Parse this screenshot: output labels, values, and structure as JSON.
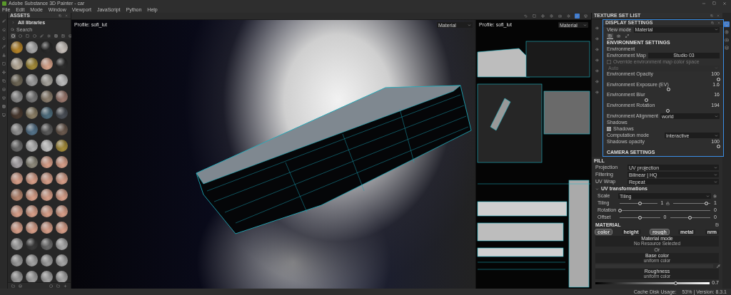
{
  "window": {
    "title": "Adobe Substance 3D Painter - car"
  },
  "menu": [
    "File",
    "Edit",
    "Mode",
    "Window",
    "Viewport",
    "JavaScript",
    "Python",
    "Help"
  ],
  "assets": {
    "title": "ASSETS",
    "library": "All libraries",
    "search": {
      "placeholder": "Search"
    },
    "filters": [
      {
        "selected": true
      },
      {
        "selected": false
      },
      {
        "selected": false
      },
      {
        "selected": false
      },
      {
        "selected": false
      },
      {
        "selected": false
      },
      {
        "selected": false
      },
      {
        "selected": false
      },
      {
        "selected": false
      }
    ],
    "materials": [
      {
        "color": "#b8862a"
      },
      {
        "color": "#a9a9a9"
      },
      {
        "color": "#2a2a2a"
      },
      {
        "color": "#c9c2bc"
      },
      {
        "color": "#b6aa98"
      },
      {
        "color": "#a48c3a"
      },
      {
        "color": "#d9a58c"
      },
      {
        "color": "#2c2c2c"
      },
      {
        "color": "#6d6655"
      },
      {
        "color": "#9a9a9a"
      },
      {
        "color": "#a6a39c"
      },
      {
        "color": "#bdbdbd"
      },
      {
        "color": "#8a8a8a"
      },
      {
        "color": "#777777"
      },
      {
        "color": "#8c7f6e"
      },
      {
        "color": "#9c7a70"
      },
      {
        "color": "#4a3a30"
      },
      {
        "color": "#8b7f66"
      },
      {
        "color": "#4f6e7e"
      },
      {
        "color": "#4a4f56"
      },
      {
        "color": "#8f8f8f"
      },
      {
        "color": "#55738a"
      },
      {
        "color": "#5a5a5a"
      },
      {
        "color": "#6b5a4e"
      },
      {
        "color": "#6a6a6a"
      },
      {
        "color": "#b0b0b0"
      },
      {
        "color": "#c4c4c4"
      },
      {
        "color": "#a88f3c"
      },
      {
        "color": "#a7a3a6"
      },
      {
        "color": "#8e8a7c"
      },
      {
        "color": "#d9a08a"
      },
      {
        "color": "#d9a08a"
      },
      {
        "color": "#d9a08a"
      },
      {
        "color": "#d9a08a"
      },
      {
        "color": "#d9a08a"
      },
      {
        "color": "#d9a08a"
      },
      {
        "color": "#b7866f"
      },
      {
        "color": "#d9a08a"
      },
      {
        "color": "#d9a08a"
      },
      {
        "color": "#d9a08a"
      },
      {
        "color": "#d9a08a"
      },
      {
        "color": "#d9a08a"
      },
      {
        "color": "#d9a08a"
      },
      {
        "color": "#d9a08a"
      },
      {
        "color": "#d9a08a"
      },
      {
        "color": "#d9a08a"
      },
      {
        "color": "#d9a08a"
      },
      {
        "color": "#d9a08a"
      },
      {
        "color": "#9c9c9c"
      },
      {
        "color": "#3a3a3a"
      },
      {
        "color": "#6a6a6a"
      },
      {
        "color": "#a8a8a8"
      },
      {
        "color": "#9a9a9a"
      },
      {
        "color": "#a2a2a2"
      },
      {
        "color": "#9e9e9e"
      },
      {
        "color": "#a6a6a6"
      },
      {
        "color": "#999999"
      },
      {
        "color": "#a0a0a0"
      },
      {
        "color": "#a3a3a3"
      },
      {
        "color": "#a5a5a5"
      }
    ]
  },
  "viewport_3d": {
    "profile": "Profile: sofl_lut",
    "mode": "Material"
  },
  "viewport_2d": {
    "profile": "Profile: sofl_lut",
    "mode": "Material"
  },
  "texture_set_list": {
    "title": "TEXTURE SET LIST"
  },
  "side_tabs": [
    {
      "selected": true
    },
    {
      "selected": false
    },
    {
      "selected": false
    },
    {
      "selected": false
    }
  ],
  "display_settings": {
    "title": "DISPLAY SETTINGS",
    "view_mode": {
      "label": "View mode",
      "value": "Material"
    },
    "tabs": [
      {
        "selected": true
      },
      {
        "selected": false
      },
      {
        "selected": false
      }
    ],
    "section": "ENVIRONMENT SETTINGS",
    "group": "Environment",
    "environment_map": {
      "label": "Environment Map",
      "value": "Studio 03"
    },
    "override": {
      "label": "Override environment map color space",
      "checked": false,
      "disabled": true
    },
    "color_space": {
      "value": "Auto",
      "disabled": true
    },
    "sliders": [
      {
        "label": "Environment Opacity",
        "reading": "100",
        "level": 1
      },
      {
        "label": "Environment Exposure (EV)",
        "reading": "1.6",
        "level": 0.55
      },
      {
        "label": "Environment Blur",
        "reading": "16",
        "level": 0.35
      },
      {
        "label": "Environment Rotation",
        "reading": "194",
        "level": 0.54
      }
    ],
    "alignment": {
      "label": "Environment Alignment",
      "value": "world"
    },
    "shadows_group": "Shadows",
    "shadows": {
      "label": "Shadows",
      "checked": true
    },
    "computation": {
      "label": "Computation mode",
      "value": "Interactive"
    },
    "shadows_opacity": {
      "label": "Shadows opacity",
      "reading": "100",
      "level": 1
    },
    "camera_section": "CAMERA SETTINGS"
  },
  "fill": {
    "title": "FILL",
    "fields": [
      {
        "label": "Projection",
        "value": "UV projection"
      },
      {
        "label": "Filtering",
        "value": "Bilinear | HQ"
      },
      {
        "label": "UV Wrap",
        "value": "Repeat"
      }
    ],
    "uv_title": "UV transformations",
    "scale": {
      "label": "Scale",
      "value": "Tiling"
    },
    "tiling": {
      "label": "Tiling",
      "sliders": [
        {
          "reading": "1",
          "level": 0.55
        },
        {
          "reading": "1",
          "level": 0.9
        }
      ]
    },
    "rotation": {
      "label": "Rotation",
      "reading": "0",
      "level": 0
    },
    "offset": {
      "label": "Offset",
      "sliders": [
        {
          "reading": "0",
          "level": 0.5
        },
        {
          "reading": "0",
          "level": 0.5
        }
      ]
    }
  },
  "material": {
    "title": "MATERIAL",
    "channels": [
      {
        "label": "color",
        "selected": true
      },
      {
        "label": "height",
        "selected": false
      },
      {
        "label": "rough",
        "selected": true
      },
      {
        "label": "metal",
        "selected": false
      },
      {
        "label": "nrm",
        "selected": false
      }
    ],
    "mode": {
      "title": "Material mode",
      "subtitle": "No Resource Selected"
    },
    "or": "Or",
    "base_color": {
      "title": "Base color",
      "subtitle": "uniform color"
    },
    "roughness": {
      "title": "Roughness",
      "subtitle": "uniform color",
      "reading": "0.7",
      "level": 0.7
    }
  },
  "status_bar": {
    "text": "Cache Disk Usage:    53% | Version: 8.3.1"
  }
}
